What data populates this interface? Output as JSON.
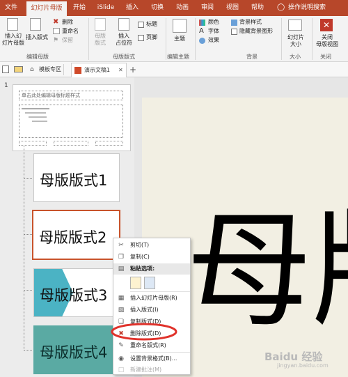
{
  "tabs": [
    {
      "label": "文件",
      "active": false
    },
    {
      "label": "幻灯片母版",
      "active": true
    },
    {
      "label": "开始",
      "active": false
    },
    {
      "label": "iSlide",
      "active": false
    },
    {
      "label": "插入",
      "active": false
    },
    {
      "label": "切换",
      "active": false
    },
    {
      "label": "动画",
      "active": false
    },
    {
      "label": "审阅",
      "active": false
    },
    {
      "label": "视图",
      "active": false
    },
    {
      "label": "帮助",
      "active": false
    }
  ],
  "tell_me": "操作说明搜索",
  "ribbon": {
    "insert_master": "插入幻\n灯片母版",
    "insert_layout": "插入版式",
    "delete": "删除",
    "rename": "重命名",
    "preserve": "保留",
    "group_edit_master": "编辑母版",
    "master_layout": "母版\n版式",
    "insert_placeholder": "插入\n占位符",
    "title_chk": "标题",
    "footer_chk": "页脚",
    "group_master_layout": "母版版式",
    "themes": "主题",
    "group_edit_theme": "编辑主题",
    "colors": "颜色",
    "fonts": "字体",
    "effects": "效果",
    "bg_styles": "背景样式",
    "hide_bg": "隐藏背景图形",
    "group_background": "背景",
    "slide_size": "幻灯片\n大小",
    "group_size": "大小",
    "close_master": "关闭\n母版视图",
    "group_close": "关闭"
  },
  "doc_tabs": {
    "template_zone": "模板专区",
    "doc_name": "演示文稿1",
    "close_x": "✕",
    "add": "+"
  },
  "thumbs": {
    "slide_number": "1",
    "master_title": "单击此处编辑母版标题样式",
    "layout1": "母版版式1",
    "layout2": "母版版式2",
    "layout3": "母版版式3",
    "layout4": "母版版式4"
  },
  "canvas_text": "母版",
  "context_menu": {
    "cut": "剪切(T)",
    "copy": "复制(C)",
    "paste_options": "粘贴选项:",
    "insert_master": "插入幻灯片母版(R)",
    "insert_layout": "插入版式(I)",
    "duplicate_layout": "复制版式(D)",
    "delete_layout": "删除版式(D)",
    "rename_layout": "重命名版式(R)",
    "format_background": "设置背景格式(B)...",
    "new_comment": "新建批注(M)"
  },
  "watermark": "Baidu 经验",
  "watermark_url": "jingyan.baidu.com",
  "colors": {
    "accent": "#b7472a",
    "highlight_circle": "#e0322b",
    "teal": "#4bb3c4",
    "teal_dark": "#5aaaa3"
  }
}
